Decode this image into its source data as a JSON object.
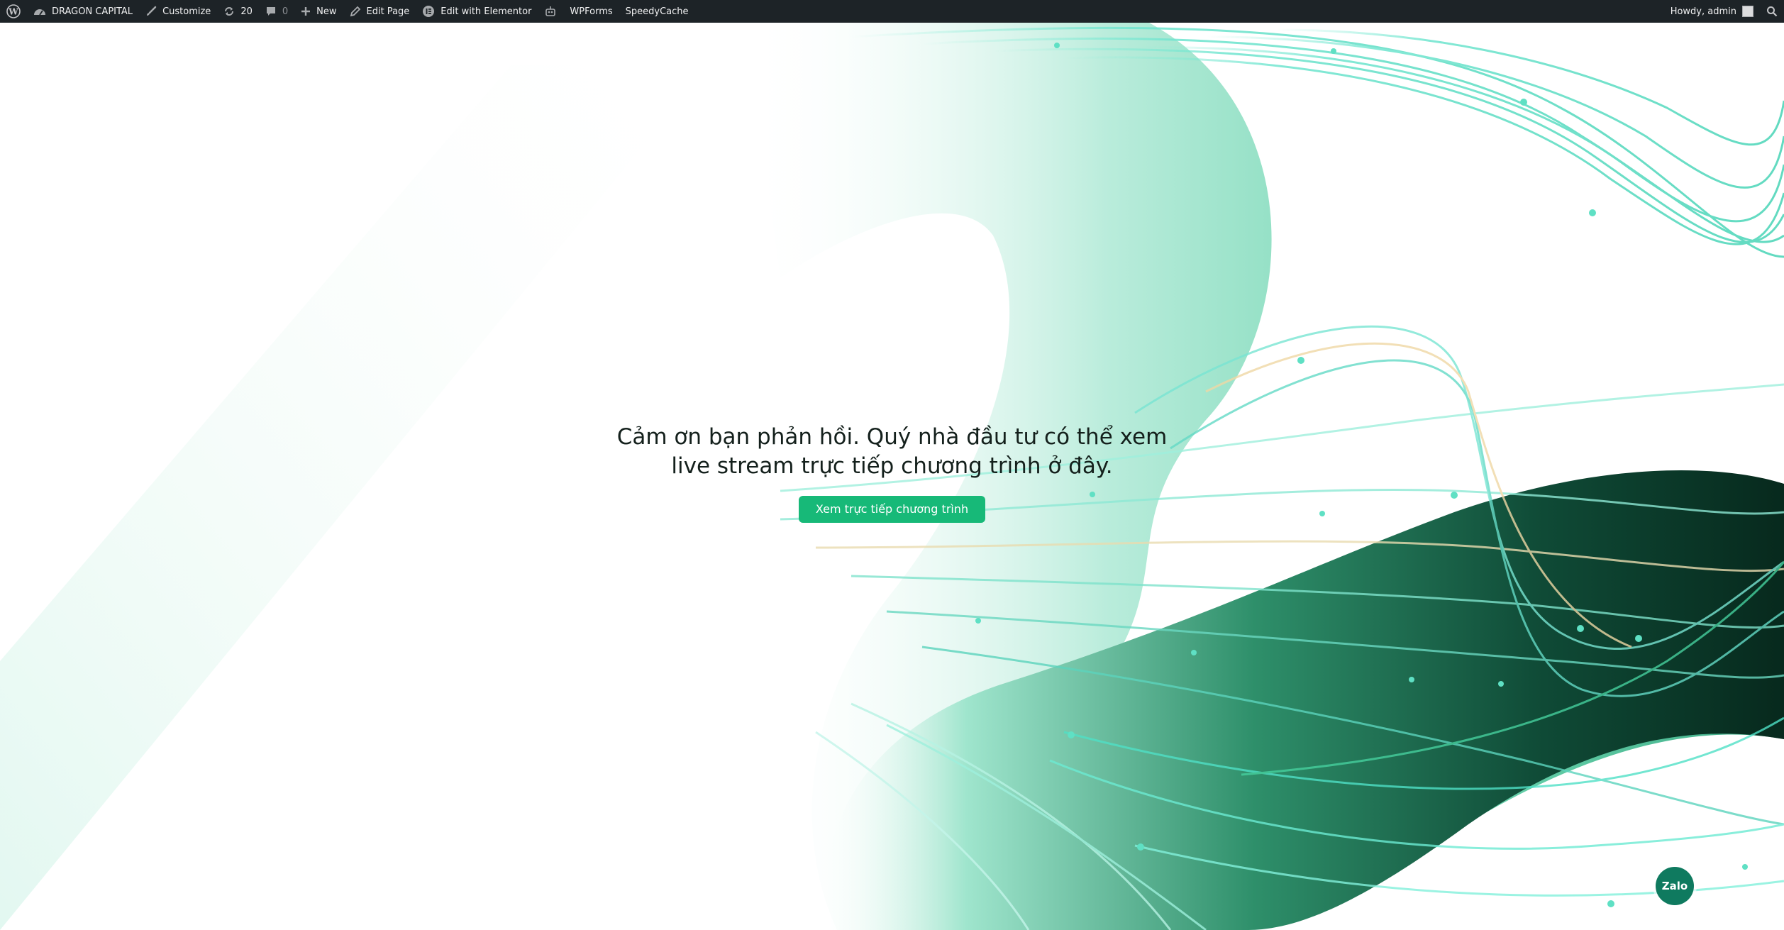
{
  "admin_bar": {
    "site_name": "DRAGON CAPITAL",
    "customize": "Customize",
    "updates_count": "20",
    "comments_count": "0",
    "new_label": "New",
    "edit_page": "Edit Page",
    "edit_elementor": "Edit with Elementor",
    "wpforms": "WPForms",
    "speedycache": "SpeedyCache",
    "greeting": "Howdy, admin"
  },
  "main": {
    "message": "Cảm ơn bạn phản hồi. Quý nhà đầu tư có thể xem live stream trực tiếp chương trình ở đây.",
    "cta_label": "Xem trực tiếp chương trình"
  },
  "zalo": {
    "label": "Zalo"
  },
  "colors": {
    "admin_bar_bg": "#1d2327",
    "brand_green": "#17b978",
    "dark_green": "#0b2b20",
    "teal": "#4fd6c0"
  },
  "icons": {
    "wordpress": "wordpress-logo-icon",
    "site": "dashboard-icon",
    "customize": "brush-icon",
    "updates": "refresh-icon",
    "comments": "comment-bubble-icon",
    "new": "plus-icon",
    "edit": "pencil-icon",
    "elementor": "elementor-icon",
    "plugin": "robot-icon",
    "search": "search-icon"
  }
}
